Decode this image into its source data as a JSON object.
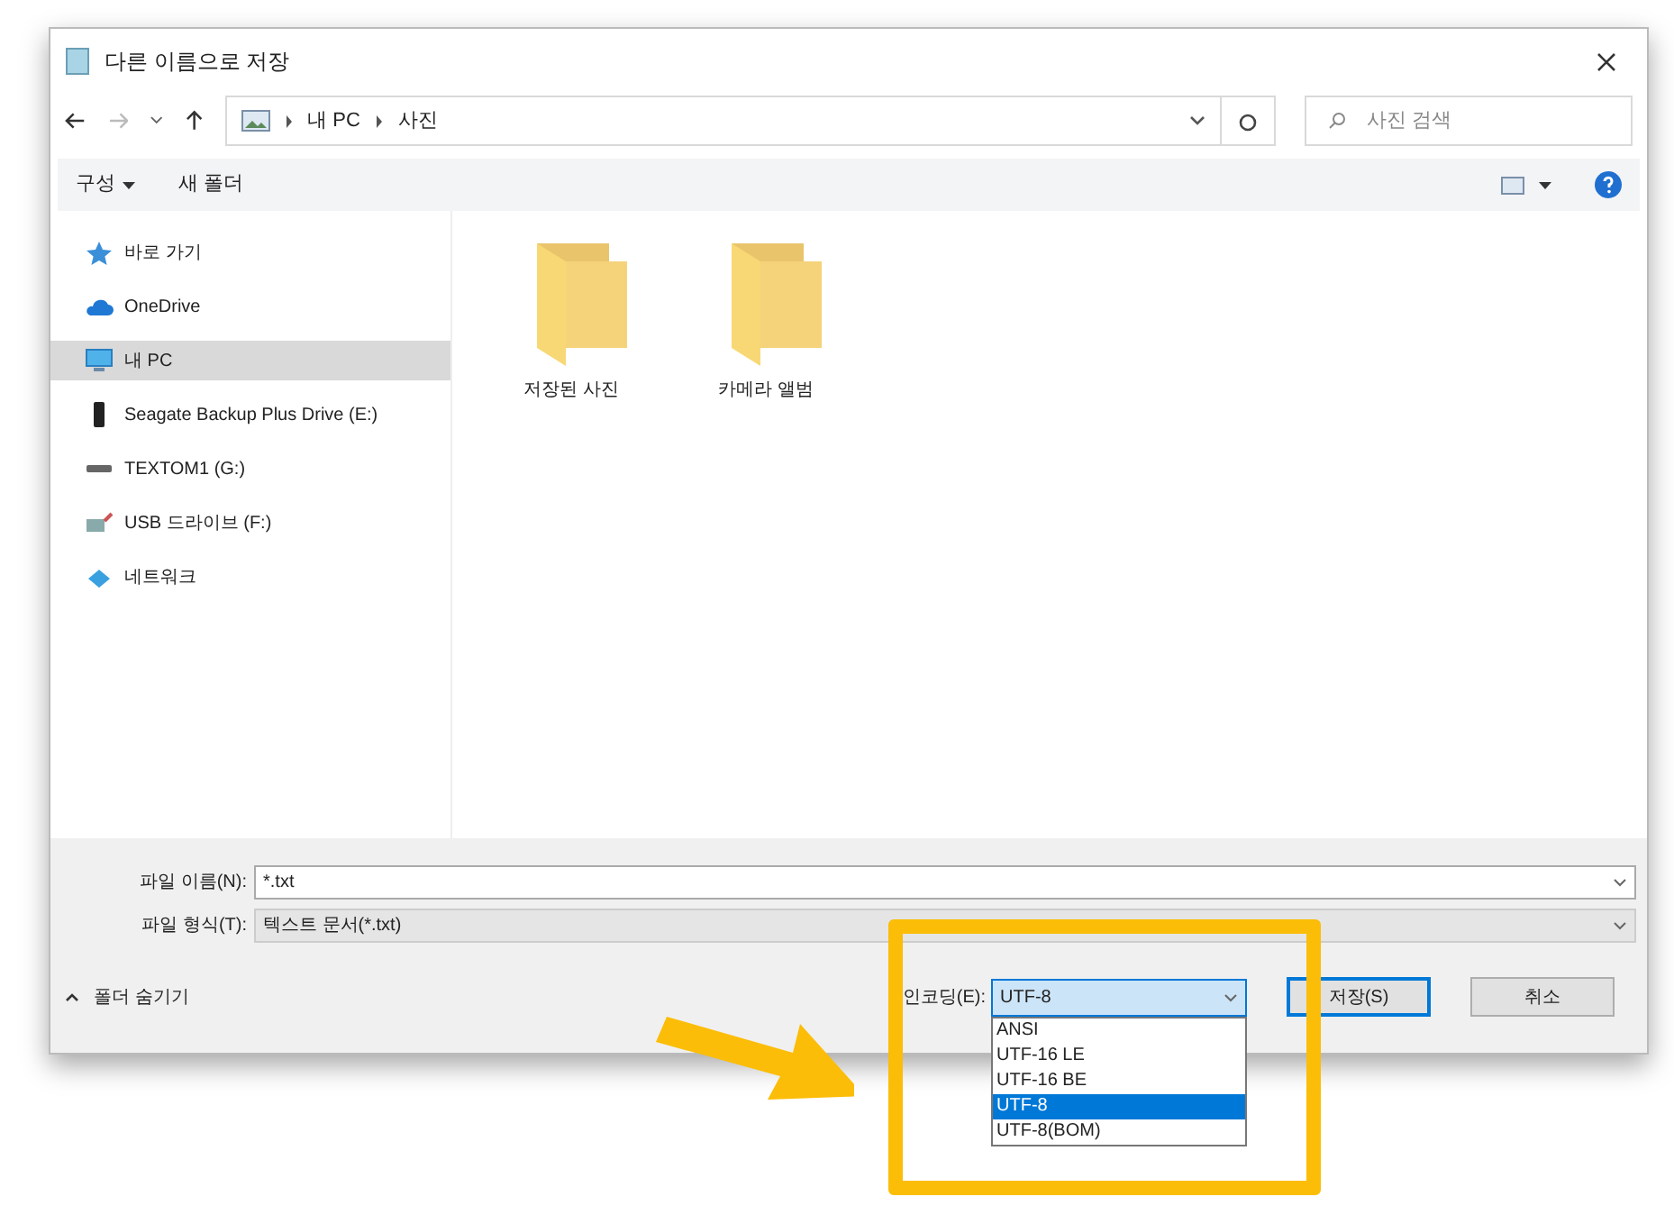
{
  "window": {
    "title": "다른 이름으로 저장"
  },
  "address": {
    "path": [
      "내 PC",
      "사진"
    ]
  },
  "search": {
    "placeholder": "사진 검색"
  },
  "toolbar": {
    "organize": "구성",
    "new_folder": "새 폴더"
  },
  "sidebar": {
    "items": [
      {
        "label": "바로 가기",
        "kind": "star",
        "selected": false
      },
      {
        "label": "OneDrive",
        "kind": "cloud",
        "selected": false
      },
      {
        "label": "내 PC",
        "kind": "pc",
        "selected": true
      },
      {
        "label": "Seagate Backup Plus Drive (E:)",
        "kind": "external",
        "selected": false
      },
      {
        "label": "TEXTOM1 (G:)",
        "kind": "drive",
        "selected": false
      },
      {
        "label": "USB 드라이브 (F:)",
        "kind": "usb",
        "selected": false
      },
      {
        "label": "네트워크",
        "kind": "network",
        "selected": false
      }
    ]
  },
  "folders": [
    {
      "name": "저장된 사진"
    },
    {
      "name": "카메라 앨범"
    }
  ],
  "file_name": {
    "label": "파일 이름(N):",
    "value": "*.txt"
  },
  "file_type": {
    "label": "파일 형식(T):",
    "value": "텍스트 문서(*.txt)"
  },
  "hide_folders": "폴더 숨기기",
  "encoding": {
    "label": "인코딩(E):",
    "value": "UTF-8",
    "expanded": true,
    "options": [
      {
        "label": "ANSI",
        "selected": false
      },
      {
        "label": "UTF-16 LE",
        "selected": false
      },
      {
        "label": "UTF-16 BE",
        "selected": false
      },
      {
        "label": "UTF-8",
        "selected": true
      },
      {
        "label": "UTF-8(BOM)",
        "selected": false
      }
    ]
  },
  "buttons": [
    {
      "label": "저장(S)",
      "kind": "primary"
    },
    {
      "label": "취소",
      "kind": "normal"
    }
  ]
}
